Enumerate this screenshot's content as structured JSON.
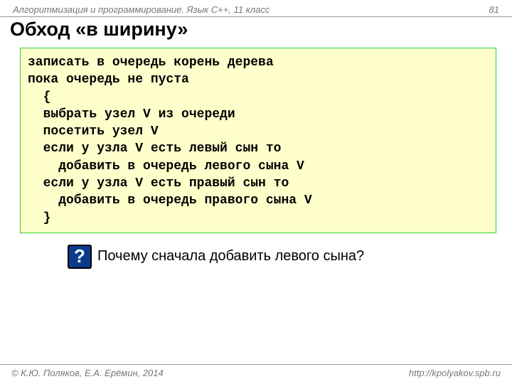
{
  "header": {
    "left": "Алгоритмизация и программирование. Язык C++, 11 класс",
    "right": "81"
  },
  "title": "Обход «в ширину»",
  "code": {
    "l1": "записать в очередь корень дерева",
    "l2": "пока очередь не пуста",
    "l3": "  {",
    "l4": "  выбрать узел V из очереди",
    "l5": "  посетить узел V",
    "l6": "  если у узла V есть левый сын то",
    "l7": "    добавить в очередь левого сына V",
    "l8": "  если у узла V есть правый сын то",
    "l9": "    добавить в очередь правого сына V",
    "l10": "  }"
  },
  "question": {
    "icon": "?",
    "text": "Почему сначала добавить левого сына?"
  },
  "footer": {
    "left": "© К.Ю. Поляков, Е.А. Ерёмин, 2014",
    "right": "http://kpolyakov.spb.ru"
  }
}
